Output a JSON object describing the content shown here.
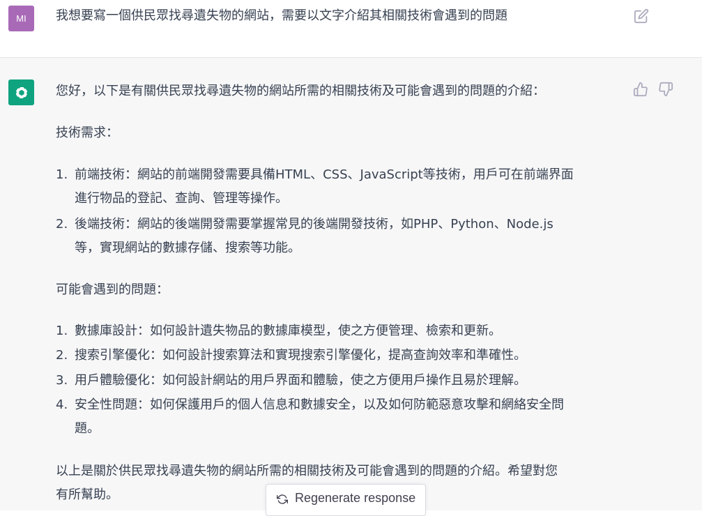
{
  "user_message": {
    "avatar_initials": "MI",
    "text": "我想要寫一個供民眾找尋遺失物的網站，需要以文字介紹其相關技術會遇到的問題"
  },
  "assistant_message": {
    "intro": "您好，以下是有關供民眾找尋遺失物的網站所需的相關技術及可能會遇到的問題的介紹：",
    "tech_heading": "技術需求：",
    "tech_items": [
      {
        "num": "1.",
        "line1": "前端技術：網站的前端開發需要具備HTML、CSS、JavaScript等技術，用戶可在前端界面",
        "line2": "進行物品的登記、查詢、管理等操作。"
      },
      {
        "num": "2.",
        "line1": "後端技術：網站的後端開發需要掌握常見的後端開發技術，如PHP、Python、Node.js",
        "line2": "等，實現網站的數據存儲、搜索等功能。"
      }
    ],
    "problems_heading": "可能會遇到的問題：",
    "problem_items": [
      {
        "num": "1.",
        "line1": "數據庫設計：如何設計遺失物品的數據庫模型，使之方便管理、檢索和更新。",
        "line2": ""
      },
      {
        "num": "2.",
        "line1": "搜索引擎優化：如何設計搜索算法和實現搜索引擎優化，提高查詢效率和準確性。",
        "line2": ""
      },
      {
        "num": "3.",
        "line1": "用戶體驗優化：如何設計網站的用戶界面和體驗，使之方便用戶操作且易於理解。",
        "line2": ""
      },
      {
        "num": "4.",
        "line1": "安全性問題：如何保護用戶的個人信息和數據安全，以及如何防範惡意攻擊和網絡安全問",
        "line2": "題。"
      }
    ],
    "closing_line1": "以上是關於供民眾找尋遺失物的網站所需的相關技術及可能會遇到的問題的介紹。希望對您",
    "closing_line2": "有所幫助。"
  },
  "regenerate_button": {
    "label": "Regenerate response"
  },
  "colors": {
    "user_avatar": "#a86ab7",
    "assistant_avatar": "#10a37f",
    "assistant_bg": "#f7f7f8",
    "text": "#374151"
  },
  "icons": {
    "edit": "edit-icon",
    "thumbs_up": "thumbs-up-icon",
    "thumbs_down": "thumbs-down-icon",
    "logo": "openai-logo-icon",
    "regenerate": "refresh-icon"
  }
}
